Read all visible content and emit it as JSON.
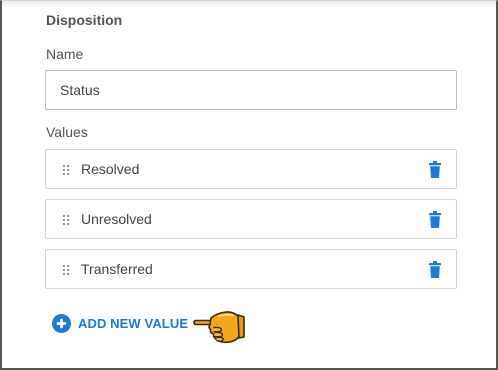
{
  "section": {
    "title": "Disposition"
  },
  "name_field": {
    "label": "Name",
    "value": "Status"
  },
  "values": {
    "label": "Values",
    "items": [
      {
        "label": "Resolved"
      },
      {
        "label": "Unresolved"
      },
      {
        "label": "Transferred"
      }
    ]
  },
  "add_button": {
    "label": "ADD NEW VALUE"
  },
  "colors": {
    "accent": "#1f7ad6",
    "pointer": "#f2a81d"
  },
  "icons": {
    "drag": "drag-handle-icon",
    "delete": "trash-icon",
    "add": "plus-circle-icon",
    "pointer": "hand-pointer-icon"
  }
}
